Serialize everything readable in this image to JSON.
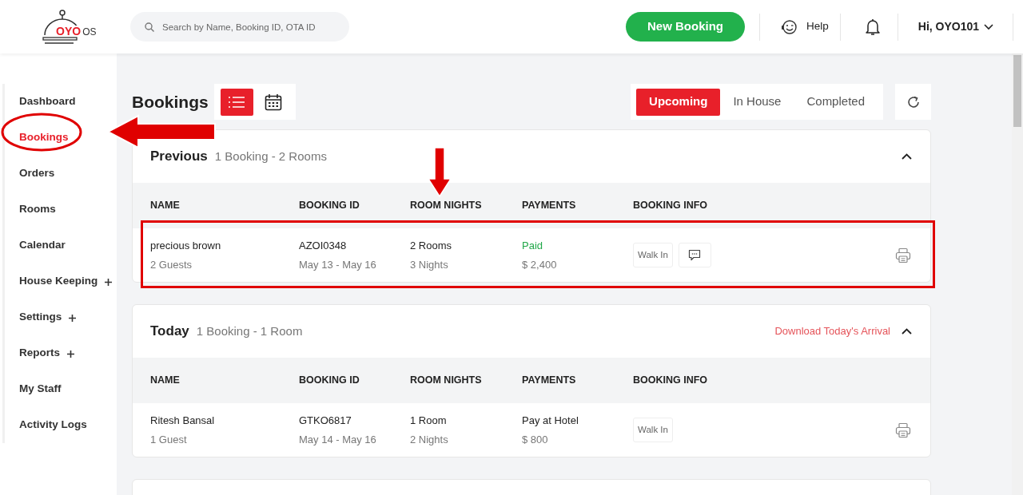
{
  "header": {
    "logo_text": "OYO",
    "logo_suffix": "OS",
    "search": {
      "placeholder": "Search by Name, Booking ID, OTA ID"
    },
    "new_booking": "New Booking",
    "help": "Help",
    "user": "Hi, OYO101"
  },
  "sidebar": {
    "items": [
      {
        "label": "Dashboard",
        "selected": false,
        "expandable": false
      },
      {
        "label": "Bookings",
        "selected": true,
        "expandable": false
      },
      {
        "label": "Orders",
        "selected": false,
        "expandable": false
      },
      {
        "label": "Rooms",
        "selected": false,
        "expandable": false
      },
      {
        "label": "Calendar",
        "selected": false,
        "expandable": false
      },
      {
        "label": "House Keeping",
        "selected": false,
        "expandable": true
      },
      {
        "label": "Settings",
        "selected": false,
        "expandable": true
      },
      {
        "label": "Reports",
        "selected": false,
        "expandable": true
      },
      {
        "label": "My Staff",
        "selected": false,
        "expandable": false
      },
      {
        "label": "Activity Logs",
        "selected": false,
        "expandable": false
      }
    ]
  },
  "page": {
    "title": "Bookings",
    "views": [
      {
        "kind": "list",
        "selected": true
      },
      {
        "kind": "calendar",
        "selected": false
      }
    ],
    "tabs": [
      {
        "label": "Upcoming",
        "selected": true
      },
      {
        "label": "In House",
        "selected": false
      },
      {
        "label": "Completed",
        "selected": false
      }
    ]
  },
  "sections": [
    {
      "title": "Previous",
      "summary": "1 Booking - 2 Rooms",
      "expanded": true,
      "columns": [
        "NAME",
        "BOOKING ID",
        "ROOM NIGHTS",
        "PAYMENTS",
        "BOOKING INFO"
      ],
      "rows": [
        {
          "name": "precious brown",
          "guests": "2 Guests",
          "booking_id": "AZOI0348",
          "dates": "May 13 - May 16",
          "rooms": "2 Rooms",
          "nights": "3 Nights",
          "payment": {
            "kind": "paid",
            "status": "Paid",
            "amount": "$ 2,400"
          },
          "source": "Walk In",
          "has_comment": true
        }
      ]
    },
    {
      "title": "Today",
      "summary": "1 Booking - 1 Room",
      "download_link": "Download Today's Arrival",
      "expanded": true,
      "columns": [
        "NAME",
        "BOOKING ID",
        "ROOM NIGHTS",
        "PAYMENTS",
        "BOOKING INFO"
      ],
      "rows": [
        {
          "name": "Ritesh Bansal",
          "guests": "1 Guest",
          "booking_id": "GTKO6817",
          "dates": "May 14 - May 16",
          "rooms": "1 Room",
          "nights": "2 Nights",
          "payment": {
            "kind": "pay-at-hotel",
            "status": "Pay at Hotel",
            "amount": "$ 800"
          },
          "source": "Walk In",
          "has_comment": false
        }
      ]
    }
  ],
  "annotations": [
    {
      "kind": "ellipse"
    },
    {
      "kind": "arrow-left"
    },
    {
      "kind": "arrow-down"
    },
    {
      "kind": "highlight-box"
    }
  ]
}
